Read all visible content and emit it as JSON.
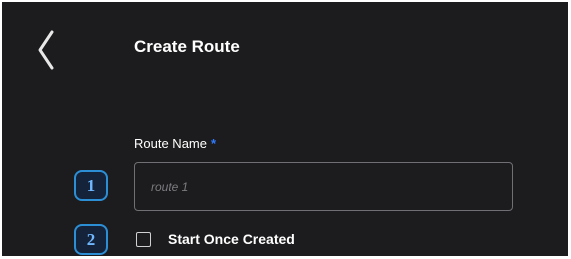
{
  "header": {
    "back_icon": "chevron-left-icon",
    "title": "Create Route"
  },
  "form": {
    "route_name": {
      "label": "Route Name",
      "required_mark": "*",
      "value": "",
      "placeholder": "route 1"
    },
    "start_once_created": {
      "label": "Start Once Created",
      "checked": false
    }
  },
  "annotations": {
    "marker_1": "1",
    "marker_2": "2"
  },
  "colors": {
    "background": "#1c1c1e",
    "accent": "#2f7bff",
    "marker_border": "#2c8fd6"
  }
}
